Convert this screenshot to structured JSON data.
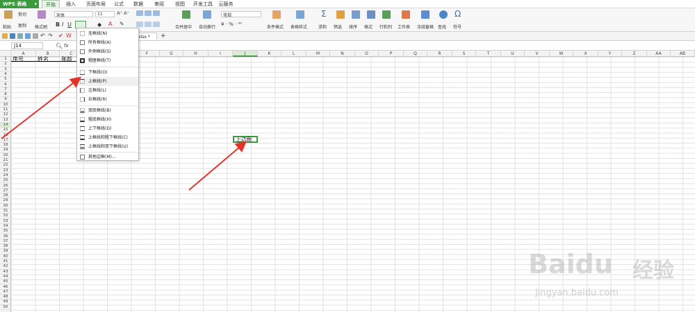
{
  "app": {
    "title": "WPS 表格",
    "menu_arrow": "▾"
  },
  "tabs": [
    "开始",
    "插入",
    "页面布局",
    "公式",
    "数据",
    "审阅",
    "视图",
    "开发工具",
    "云服务"
  ],
  "ribbon": {
    "paste": "粘贴",
    "cut": "剪切",
    "copy": "复制",
    "format_painter": "格式刷",
    "font_name": "宋体",
    "font_size": "11",
    "number_format": "常规",
    "merge_center": "合并居中",
    "wrap_text": "自动换行",
    "conditional_format": "条件格式",
    "table_style": "表格样式",
    "sum": "求和",
    "filter": "筛选",
    "sort": "排序",
    "format": "格式",
    "row_col": "行和列",
    "worksheet": "工作表",
    "freeze": "冻结窗格",
    "find": "查找",
    "symbol": "符号"
  },
  "doc_tab": "xlsx *",
  "formula_bar": {
    "name_box": "J14",
    "fx": "fx"
  },
  "columns": [
    "A",
    "B",
    "C",
    "D",
    "E",
    "F",
    "G",
    "H",
    "I",
    "J",
    "K",
    "L",
    "M",
    "N",
    "O",
    "P",
    "Q",
    "R",
    "S",
    "T",
    "U",
    "V",
    "W",
    "X",
    "Y",
    "Z",
    "AA",
    "AB"
  ],
  "rows": [
    "1",
    "2",
    "3",
    "4",
    "5",
    "6",
    "7",
    "8",
    "9",
    "10",
    "11",
    "12",
    "13",
    "14",
    "15",
    "16",
    "17",
    "18",
    "19",
    "20",
    "21",
    "22",
    "23",
    "24",
    "25",
    "26",
    "27",
    "28",
    "29",
    "30",
    "31",
    "32",
    "33",
    "34",
    "35",
    "36",
    "37",
    "38",
    "39",
    "40",
    "41",
    "42",
    "43",
    "44",
    "45",
    "46",
    "47",
    "48",
    "49",
    "50"
  ],
  "cells": {
    "a1": "序号",
    "b1": "姓名",
    "c1": "年龄",
    "j14": "上边框"
  },
  "border_menu": [
    "无框线(N)",
    "所有框线(A)",
    "外侧框线(S)",
    "粗匣框线(T)",
    "下框线(O)",
    "上框线(P)",
    "左框线(L)",
    "右框线(R)",
    "双底框线(B)",
    "粗底框线(H)",
    "上下框线(D)",
    "上框线和粗下框线(C)",
    "上框线和双下框线(U)",
    "其他边框(M)..."
  ],
  "watermark": {
    "brand": "Baidu",
    "cn": "经验",
    "url": "jingyan.baidu.com"
  },
  "colors": {
    "accent": "#3a9a3c",
    "arrow": "#e5332a"
  }
}
